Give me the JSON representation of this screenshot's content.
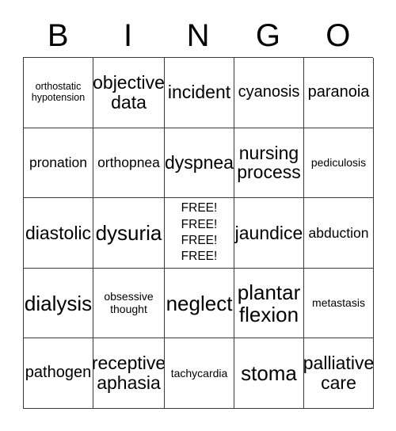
{
  "card": {
    "title_letters": [
      "B",
      "I",
      "N",
      "G",
      "O"
    ],
    "free_space_text": "FREE!\nFREE!\nFREE!\nFREE!",
    "border_color": "#3a3a3a",
    "background_color": "#ffffff",
    "text_color": "#000000",
    "rows": [
      [
        {
          "text": "orthostatic\nhypotension",
          "size": "xs"
        },
        {
          "text": "objective\ndata",
          "size": "xl"
        },
        {
          "text": "incident",
          "size": "xl"
        },
        {
          "text": "cyanosis",
          "size": "lg"
        },
        {
          "text": "paranoia",
          "size": "lg"
        }
      ],
      [
        {
          "text": "pronation",
          "size": "md"
        },
        {
          "text": "orthopnea",
          "size": "md"
        },
        {
          "text": "dyspnea",
          "size": "xl"
        },
        {
          "text": "nursing\nprocess",
          "size": "xl"
        },
        {
          "text": "pediculosis",
          "size": "sm"
        }
      ],
      [
        {
          "text": "diastolic",
          "size": "xl"
        },
        {
          "text": "dysuria",
          "size": "xxl"
        },
        {
          "text": "FREE!\nFREE!\nFREE!\nFREE!",
          "size": "free"
        },
        {
          "text": "jaundice",
          "size": "xl"
        },
        {
          "text": "abduction",
          "size": "md"
        }
      ],
      [
        {
          "text": "dialysis",
          "size": "xxl"
        },
        {
          "text": "obsessive\nthought",
          "size": "sm"
        },
        {
          "text": "neglect",
          "size": "xxl"
        },
        {
          "text": "plantar\nflexion",
          "size": "xxl"
        },
        {
          "text": "metastasis",
          "size": "sm"
        }
      ],
      [
        {
          "text": "pathogen",
          "size": "lg"
        },
        {
          "text": "receptive\naphasia",
          "size": "xl"
        },
        {
          "text": "tachycardia",
          "size": "sm"
        },
        {
          "text": "stoma",
          "size": "xxl"
        },
        {
          "text": "palliative\ncare",
          "size": "xl"
        }
      ]
    ]
  }
}
